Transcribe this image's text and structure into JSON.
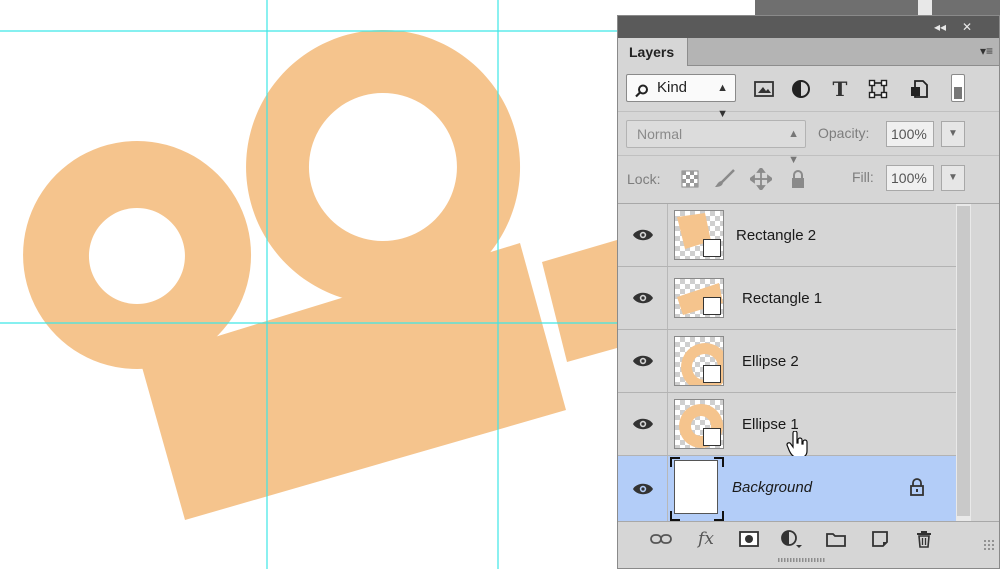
{
  "panel": {
    "title_tab": "Layers",
    "collapse_glyph": "◂◂",
    "close_glyph": "✕",
    "menu_glyph": "▾≡"
  },
  "filter": {
    "kind_label": "Kind",
    "filter_icons": [
      "image-filter-icon",
      "adjustment-filter-icon",
      "type-filter-icon",
      "shape-filter-icon",
      "smart-object-filter-icon"
    ]
  },
  "blend": {
    "mode": "Normal",
    "opacity_label": "Opacity:",
    "opacity_value": "100%",
    "fill_label": "Fill:",
    "fill_value": "100%",
    "lock_label": "Lock:"
  },
  "layers": [
    {
      "name": "Rectangle 2",
      "visible": true,
      "selected": false
    },
    {
      "name": "Rectangle 1",
      "visible": true,
      "selected": false
    },
    {
      "name": "Ellipse 2",
      "visible": true,
      "selected": false
    },
    {
      "name": "Ellipse 1",
      "visible": true,
      "selected": false
    },
    {
      "name": "Background",
      "visible": true,
      "selected": true,
      "locked": true
    }
  ],
  "bottom_icons": [
    "link-layers-icon",
    "fx-icon",
    "add-mask-icon",
    "adjustment-layer-icon",
    "group-folder-icon",
    "new-layer-icon",
    "trash-icon"
  ],
  "colors": {
    "shape_fill": "#f5c48d",
    "guide": "#3ee6e6",
    "selection": "#b3cdf8",
    "panel_bg": "#d6d6d6"
  }
}
